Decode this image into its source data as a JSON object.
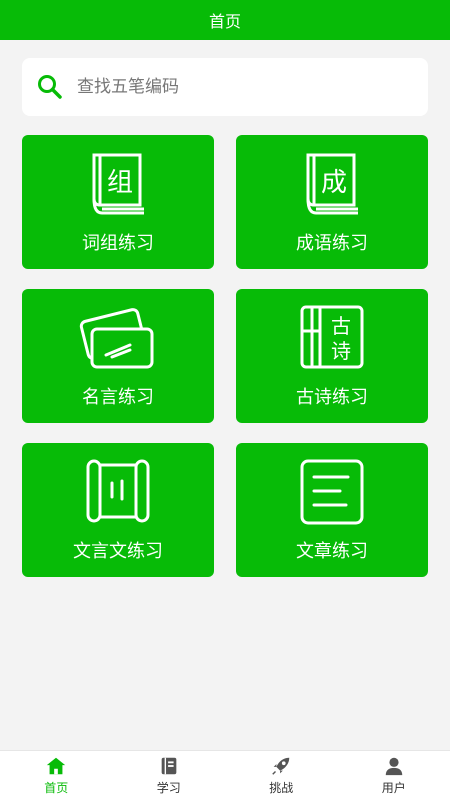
{
  "header": {
    "title": "首页"
  },
  "search": {
    "placeholder": "查找五笔编码"
  },
  "cards": [
    {
      "label": "词组练习",
      "icon": "book-icon",
      "glyph": "组"
    },
    {
      "label": "成语练习",
      "icon": "book-icon",
      "glyph": "成"
    },
    {
      "label": "名言练习",
      "icon": "cards-icon"
    },
    {
      "label": "古诗练习",
      "icon": "poem-scroll-icon",
      "glyph1": "古",
      "glyph2": "诗"
    },
    {
      "label": "文言文练习",
      "icon": "scroll-icon"
    },
    {
      "label": "文章练习",
      "icon": "document-icon"
    }
  ],
  "tabs": [
    {
      "label": "首页",
      "icon": "home-icon",
      "active": true
    },
    {
      "label": "学习",
      "icon": "notebook-icon"
    },
    {
      "label": "挑战",
      "icon": "rocket-icon"
    },
    {
      "label": "用户",
      "icon": "user-icon"
    }
  ],
  "colors": {
    "primary": "#07bb07",
    "background": "#f3f3f3",
    "tab_inactive": "#555555"
  }
}
